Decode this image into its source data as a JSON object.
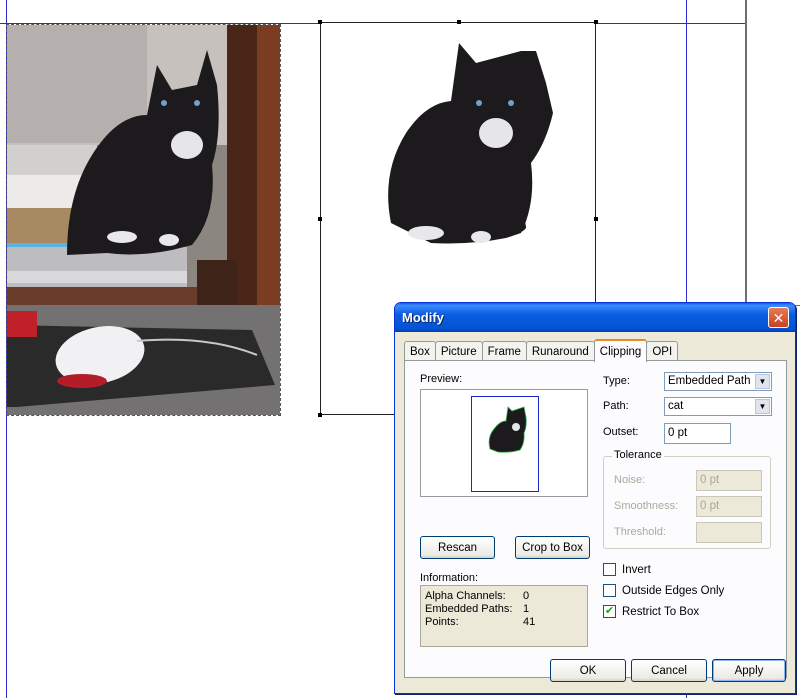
{
  "dialog": {
    "title": "Modify",
    "tabs": [
      "Box",
      "Picture",
      "Frame",
      "Runaround",
      "Clipping",
      "OPI"
    ],
    "active_tab": "Clipping",
    "preview_label": "Preview:",
    "rescan_button": "Rescan",
    "crop_button": "Crop to Box",
    "information_label": "Information:",
    "info": [
      {
        "key": "Alpha Channels:",
        "value": "0"
      },
      {
        "key": "Embedded Paths:",
        "value": "1"
      },
      {
        "key": "Points:",
        "value": "41"
      }
    ],
    "type_label": "Type:",
    "type_value": "Embedded Path",
    "path_label": "Path:",
    "path_value": "cat",
    "outset_label": "Outset:",
    "outset_value": "0 pt",
    "tolerance_label": "Tolerance",
    "noise_label": "Noise:",
    "noise_value": "0 pt",
    "smoothness_label": "Smoothness:",
    "smoothness_value": "0 pt",
    "threshold_label": "Threshold:",
    "threshold_value": "",
    "invert_label": "Invert",
    "invert_checked": false,
    "outside_edges_label": "Outside Edges Only",
    "outside_edges_checked": false,
    "restrict_label": "Restrict To Box",
    "restrict_checked": true,
    "ok_button": "OK",
    "cancel_button": "Cancel",
    "apply_button": "Apply",
    "close_glyph": "✕"
  },
  "colors": {
    "guide": "#2a2ad0",
    "title_bar": "#0453d4",
    "dialog_face": "#ece9d8",
    "active_tab_accent": "#e68b2c"
  }
}
